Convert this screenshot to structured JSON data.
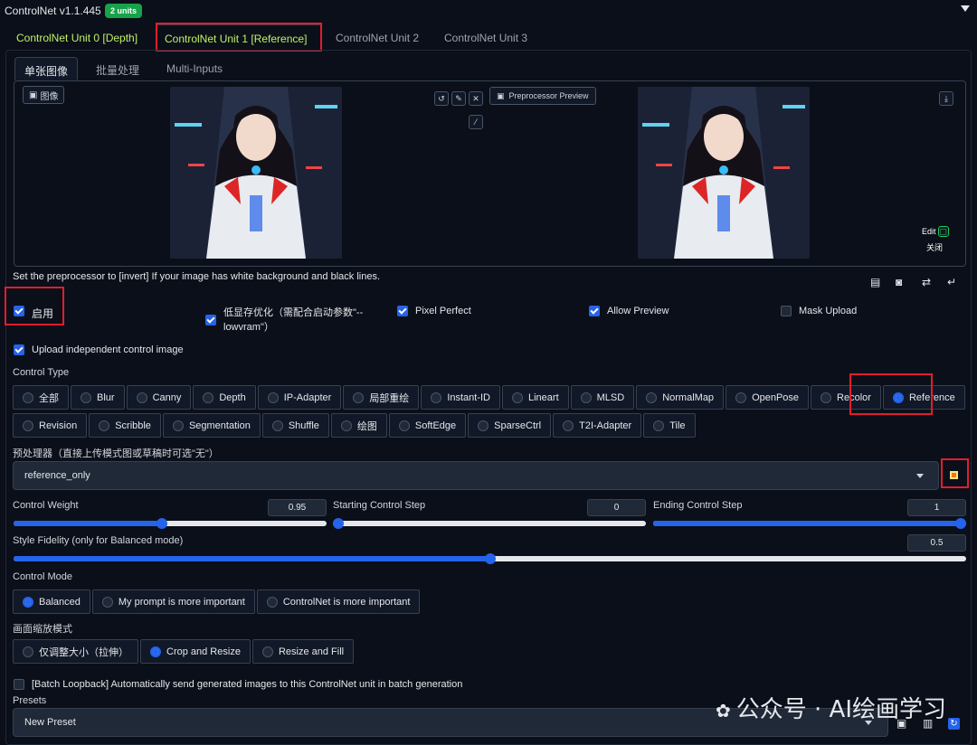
{
  "header": {
    "title": "ControlNet v1.1.445",
    "units_badge": "2 units"
  },
  "unit_tabs": [
    {
      "label": "ControlNet Unit 0 [Depth]"
    },
    {
      "label": "ControlNet Unit 1 [Reference]"
    },
    {
      "label": "ControlNet Unit 2"
    },
    {
      "label": "ControlNet Unit 3"
    }
  ],
  "image_tabs": [
    {
      "label": "单张图像"
    },
    {
      "label": "批量处理"
    },
    {
      "label": "Multi-Inputs"
    }
  ],
  "image_area": {
    "image_label": "图像",
    "preprocessor_preview": "Preprocessor Preview",
    "edit_label": "Edit",
    "close_label": "关闭"
  },
  "hint": "Set the preprocessor to [invert] If your image has white background and black lines.",
  "options": {
    "enable": {
      "label": "启用",
      "checked": true
    },
    "low_vram": {
      "label": "低显存优化（需配合启动参数\"--lowvram\"）",
      "checked": true
    },
    "pixel_perfect": {
      "label": "Pixel Perfect",
      "checked": true
    },
    "allow_preview": {
      "label": "Allow Preview",
      "checked": true
    },
    "mask_upload": {
      "label": "Mask Upload",
      "checked": false
    },
    "upload_independent": {
      "label": "Upload independent control image",
      "checked": true
    }
  },
  "control_type": {
    "label": "Control Type",
    "row1": [
      "全部",
      "Blur",
      "Canny",
      "Depth",
      "IP-Adapter",
      "局部重绘",
      "Instant-ID",
      "Lineart",
      "MLSD",
      "NormalMap",
      "OpenPose",
      "Recolor",
      "Reference"
    ],
    "row2": [
      "Revision",
      "Scribble",
      "Segmentation",
      "Shuffle",
      "绘图",
      "SoftEdge",
      "SparseCtrl",
      "T2I-Adapter",
      "Tile"
    ],
    "selected": "Reference"
  },
  "preprocessor": {
    "label": "预处理器（直接上传模式图或草稿时可选\"无\"）",
    "value": "reference_only"
  },
  "sliders": {
    "control_weight": {
      "label": "Control Weight",
      "value": "0.95",
      "fraction": 0.475
    },
    "starting_step": {
      "label": "Starting Control Step",
      "value": "0",
      "fraction": 0
    },
    "ending_step": {
      "label": "Ending Control Step",
      "value": "1",
      "fraction": 1
    },
    "style_fidelity": {
      "label": "Style Fidelity (only for Balanced mode)",
      "value": "0.5",
      "fraction": 0.5
    }
  },
  "control_mode": {
    "label": "Control Mode",
    "options": [
      "Balanced",
      "My prompt is more important",
      "ControlNet is more important"
    ],
    "selected": "Balanced"
  },
  "resize_mode": {
    "label": "画面缩放模式",
    "options": [
      "仅调整大小（拉伸）",
      "Crop and Resize",
      "Resize and Fill"
    ],
    "selected": "Crop and Resize"
  },
  "batch_loopback": {
    "label": "[Batch Loopback] Automatically send generated images to this ControlNet unit in batch generation",
    "checked": false
  },
  "presets": {
    "label": "Presets",
    "value": "New Preset"
  },
  "watermark": "公众号 · AI绘画学习",
  "colors": {
    "accent": "#2563eb",
    "active_tab": "#bef264",
    "badge": "#16a34a",
    "highlight": "#e11d2e"
  }
}
